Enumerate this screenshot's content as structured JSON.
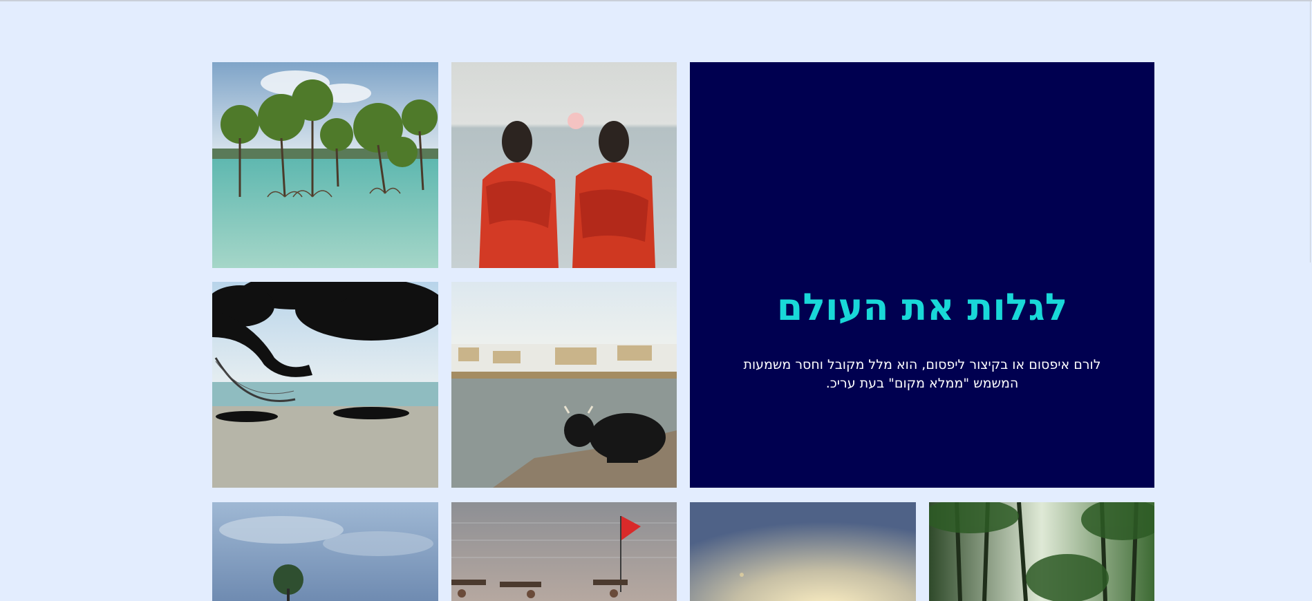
{
  "hero": {
    "title": "לגלות את העולם",
    "text": "לורם איפסום או בקיצור ליפסום, הוא מלל מקובל וחסר משמעות המשמש \"ממלא מקום\" בעת עריכ."
  },
  "gallery": {
    "images": [
      {
        "name": "mangrove-trees-photo",
        "alt": "mangrove trees in shallow water"
      },
      {
        "name": "two-women-sunset-photo",
        "alt": "two women in red saris facing sea at sunset"
      },
      {
        "name": "hammock-beach-photo",
        "alt": "hammock under tree on rocky beach"
      },
      {
        "name": "cow-lakeside-town-photo",
        "alt": "black cow resting by a lake with white town"
      },
      {
        "name": "island-tree-photo",
        "alt": "lone tree against cloudy sky"
      },
      {
        "name": "beach-flag-photo",
        "alt": "sea with a red flag and people carrying wood"
      },
      {
        "name": "sunset-sky-photo",
        "alt": "hazy sunset sky"
      },
      {
        "name": "palm-forest-photo",
        "alt": "sunlight through palm trees"
      }
    ]
  },
  "colors": {
    "page_background": "#e3edfe",
    "hero_background": "#000050",
    "hero_title": "#19d8d8",
    "hero_text": "#ffffff"
  }
}
